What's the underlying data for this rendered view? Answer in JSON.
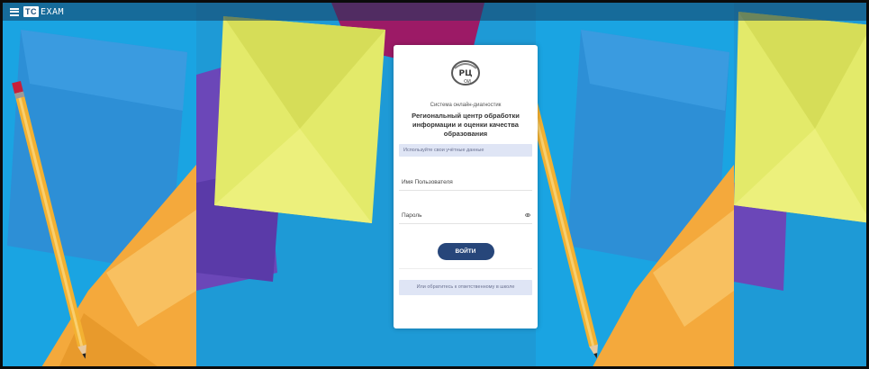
{
  "topbar": {
    "menu_icon": "hamburger-menu-icon",
    "logo_tc": "TC",
    "logo_exam": "EXAM"
  },
  "card": {
    "logo_icon": "ricuo-logo",
    "system_text": "Система онлайн-диагностик",
    "org_title": "Региональный центр обработки информации и оценки качества образования",
    "hint": "Используйте свои учётные данные",
    "username_label": "Имя Пользователя",
    "password_label": "Пароль",
    "password_toggle_icon": "eye-icon",
    "login_button": "ВОЙТИ",
    "contact_text": "Или обратитесь к ответственному в школе"
  },
  "colors": {
    "background_blue": "#1a9fdc",
    "button": "#27467a",
    "hint_bg": "#dfe5f5",
    "envelope_yellow": "#e3ea6a",
    "paper_orange": "#f4a93c",
    "paper_purple": "#6b47b8",
    "paper_magenta": "#9c1a66"
  }
}
